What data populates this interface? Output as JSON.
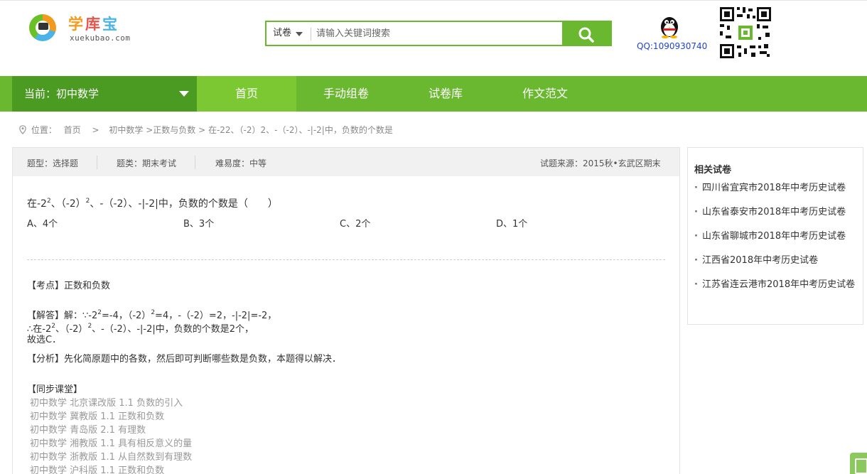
{
  "logo": {
    "cn_1": "学",
    "cn_2": "库",
    "cn_3": "宝",
    "en": "xuekubao.com"
  },
  "search": {
    "type_label": "试卷",
    "placeholder": "请输入关键词搜索"
  },
  "qq": {
    "text": "QQ:1090930740"
  },
  "nav": {
    "current": "当前：初中数学",
    "items": [
      "首页",
      "手动组卷",
      "试卷库",
      "作文范文"
    ]
  },
  "breadcrumb": {
    "prefix": "位置：",
    "home": "首页",
    "arrow": ">",
    "path": "初中数学 >正数与负数 > 在-22、（-2）2、-（-2）、-|-2|中，负数的个数是"
  },
  "info": {
    "type": "题型：选择题",
    "category": "题类：期末考试",
    "difficulty": "难易度：中等",
    "source": "试题来源：2015秋•玄武区期末"
  },
  "question": {
    "p1": "在-2",
    "s1": "2",
    "p2": "、（-2）",
    "s2": "2",
    "p3": "、-（-2）、-|-2|中，负数的个数是（　　）",
    "options": [
      "A、4个",
      "B、3个",
      "C、2个",
      "D、1个"
    ]
  },
  "kaodian": {
    "label": "【考点】",
    "text": "正数和负数"
  },
  "jieda": {
    "label": "【解答】",
    "l1a": "解：∵-2",
    "l1s1": "2",
    "l1b": "=-4，（-2）",
    "l1s2": "2",
    "l1c": "=4，-（-2）=2，-|-2|=-2，",
    "l2a": "∴在-2",
    "l2s1": "2",
    "l2b": "、（-2）",
    "l2s2": "2",
    "l2c": "、-（-2）、-|-2|中，负数的个数是2个，",
    "l3": "故选C．"
  },
  "fenxi": {
    "label": "【分析】",
    "text": "先化简原题中的各数，然后即可判断哪些数是负数，本题得以解决．"
  },
  "sync": {
    "label": "【同步课堂】",
    "items": [
      "初中数学 北京课改版 1.1 负数的引入",
      "初中数学 冀教版 1.1 正数和负数",
      "初中数学 青岛版 2.1 有理数",
      "初中数学 湘教版 1.1 具有相反意义的量",
      "初中数学 浙教版 1.1 从自然数到有理数",
      "初中数学 沪科版 1.1 正数和负数"
    ]
  },
  "sidebar": {
    "title": "相关试卷",
    "items": [
      "四川省宜宾市2018年中考历史试卷",
      "山东省泰安市2018年中考历史试卷",
      "山东省聊城市2018年中考历史试卷",
      "江西省2018年中考历史试卷",
      "江苏省连云港市2018年中考历史试卷"
    ]
  },
  "colors": {
    "brand_green": "#6ab82f",
    "dark_green": "#4b9a22",
    "active_green": "#7cc832",
    "qq_blue": "#2244cc"
  },
  "icons": [
    "logo-icon",
    "caret-down-icon",
    "search-icon",
    "qq-penguin-icon",
    "qr-code-icon",
    "location-pin-icon",
    "feedback-icon"
  ]
}
